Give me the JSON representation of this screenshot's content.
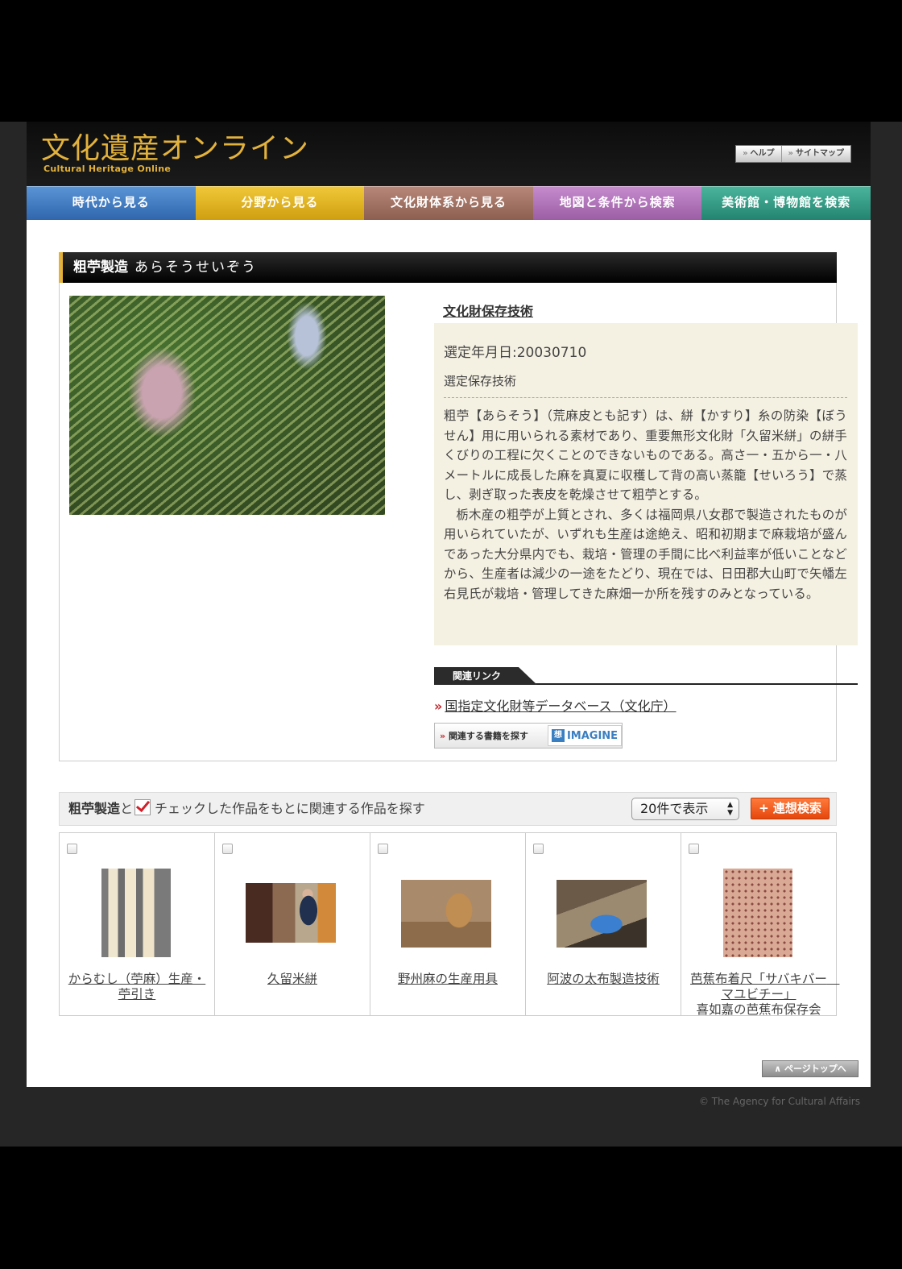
{
  "header": {
    "logo_jp": "文化遺産オンライン",
    "logo_en": "Cultural Heritage Online",
    "help": "ヘルプ",
    "sitemap": "サイトマップ"
  },
  "nav": {
    "items": [
      {
        "label": "時代から見る",
        "color": "#3e7bc2"
      },
      {
        "label": "分野から見る",
        "color": "#e2b51c"
      },
      {
        "label": "文化財体系から見る",
        "color": "#9e6f60"
      },
      {
        "label": "地図と条件から検索",
        "color": "#b071b8"
      },
      {
        "label": "美術館・博物館を検索",
        "color": "#2e9b84"
      }
    ]
  },
  "page": {
    "title": "粗苧製造",
    "title_reading": "あらそうせいぞう",
    "category": "文化財保存技術",
    "selected_date": "選定年月日:20030710",
    "designation": "選定保存技術",
    "desc_p1": "粗苧【あらそう】（荒麻皮とも記す）は、絣【かすり】糸の防染【ぼうせん】用に用いられる素材であり、重要無形文化財「久留米絣」の絣手くびりの工程に欠くことのできないものである。高さ一・五から一・八メートルに成長した麻を真夏に収穫して背の高い蒸籠【せいろう】で蒸し、剥ぎ取った表皮を乾燥させて粗苧とする。",
    "desc_p2": "栃木産の粗苧が上質とされ、多くは福岡県八女郡で製造されたものが用いられていたが、いずれも生産は途絶え、昭和初期まで麻栽培が盛んであった大分県内でも、栽培・管理の手間に比べ利益率が低いことなどから、生産者は減少の一途をたどり、現在では、日田郡大山町で矢幡左右見氏が栽培・管理してきた麻畑一か所を残すのみとなっている。"
  },
  "related": {
    "heading": "関連リンク",
    "link": "国指定文化財等データベース（文化庁）",
    "imagine_label": "関連する書籍を探す",
    "imagine_logo": "IMAGINE"
  },
  "search": {
    "title_prefix": "粗苧製造",
    "text_to": "と",
    "text_rest": "チェックした作品をもとに関連する作品を探す",
    "select_value": "20件で表示",
    "button": "連想検索"
  },
  "results": [
    {
      "title": "からむし（苧麻）生産・苧引き",
      "subtitle": ""
    },
    {
      "title": "久留米絣",
      "subtitle": ""
    },
    {
      "title": "野州麻の生産用具",
      "subtitle": ""
    },
    {
      "title": "阿波の太布製造技術",
      "subtitle": ""
    },
    {
      "title": "芭蕉布着尺「サバキバー　マユビチー」",
      "subtitle": "喜如嘉の芭蕉布保存会"
    }
  ],
  "footer": {
    "pagetop": "ページトップへ",
    "copyright": "© The Agency for Cultural Affairs"
  }
}
